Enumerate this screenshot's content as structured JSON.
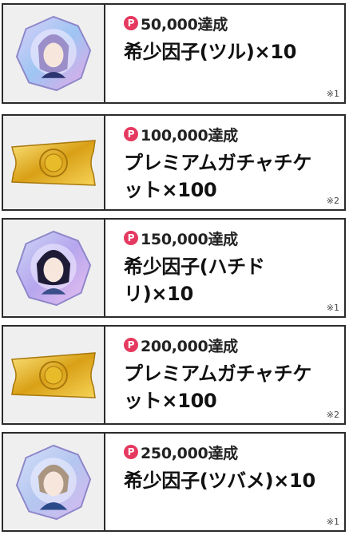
{
  "rewards": [
    {
      "milestone": "50,000達成",
      "reward": "希少因子(ツル)×10",
      "note": "※1",
      "item": "rare-factor-crystal",
      "crystal_color": "#b9a6e8"
    },
    {
      "milestone": "100,000達成",
      "reward": "プレミアムガチャチケット×100",
      "note": "※2",
      "item": "premium-gacha-ticket"
    },
    {
      "milestone": "150,000達成",
      "reward": "希少因子(ハチドリ)×10",
      "note": "※1",
      "item": "rare-factor-crystal",
      "crystal_color": "#a6b6ee"
    },
    {
      "milestone": "200,000達成",
      "reward": "プレミアムガチャチケット×100",
      "note": "※2",
      "item": "premium-gacha-ticket"
    },
    {
      "milestone": "250,000達成",
      "reward": "希少因子(ツバメ)×10",
      "note": "※1",
      "item": "rare-factor-crystal",
      "crystal_color": "#b6c4ee"
    }
  ],
  "badge_label": "P",
  "colors": {
    "badge": "#e5395f",
    "border": "#2b2b2b",
    "thumb_bg": "#efefef",
    "ticket_gold": "#e3b21f"
  }
}
